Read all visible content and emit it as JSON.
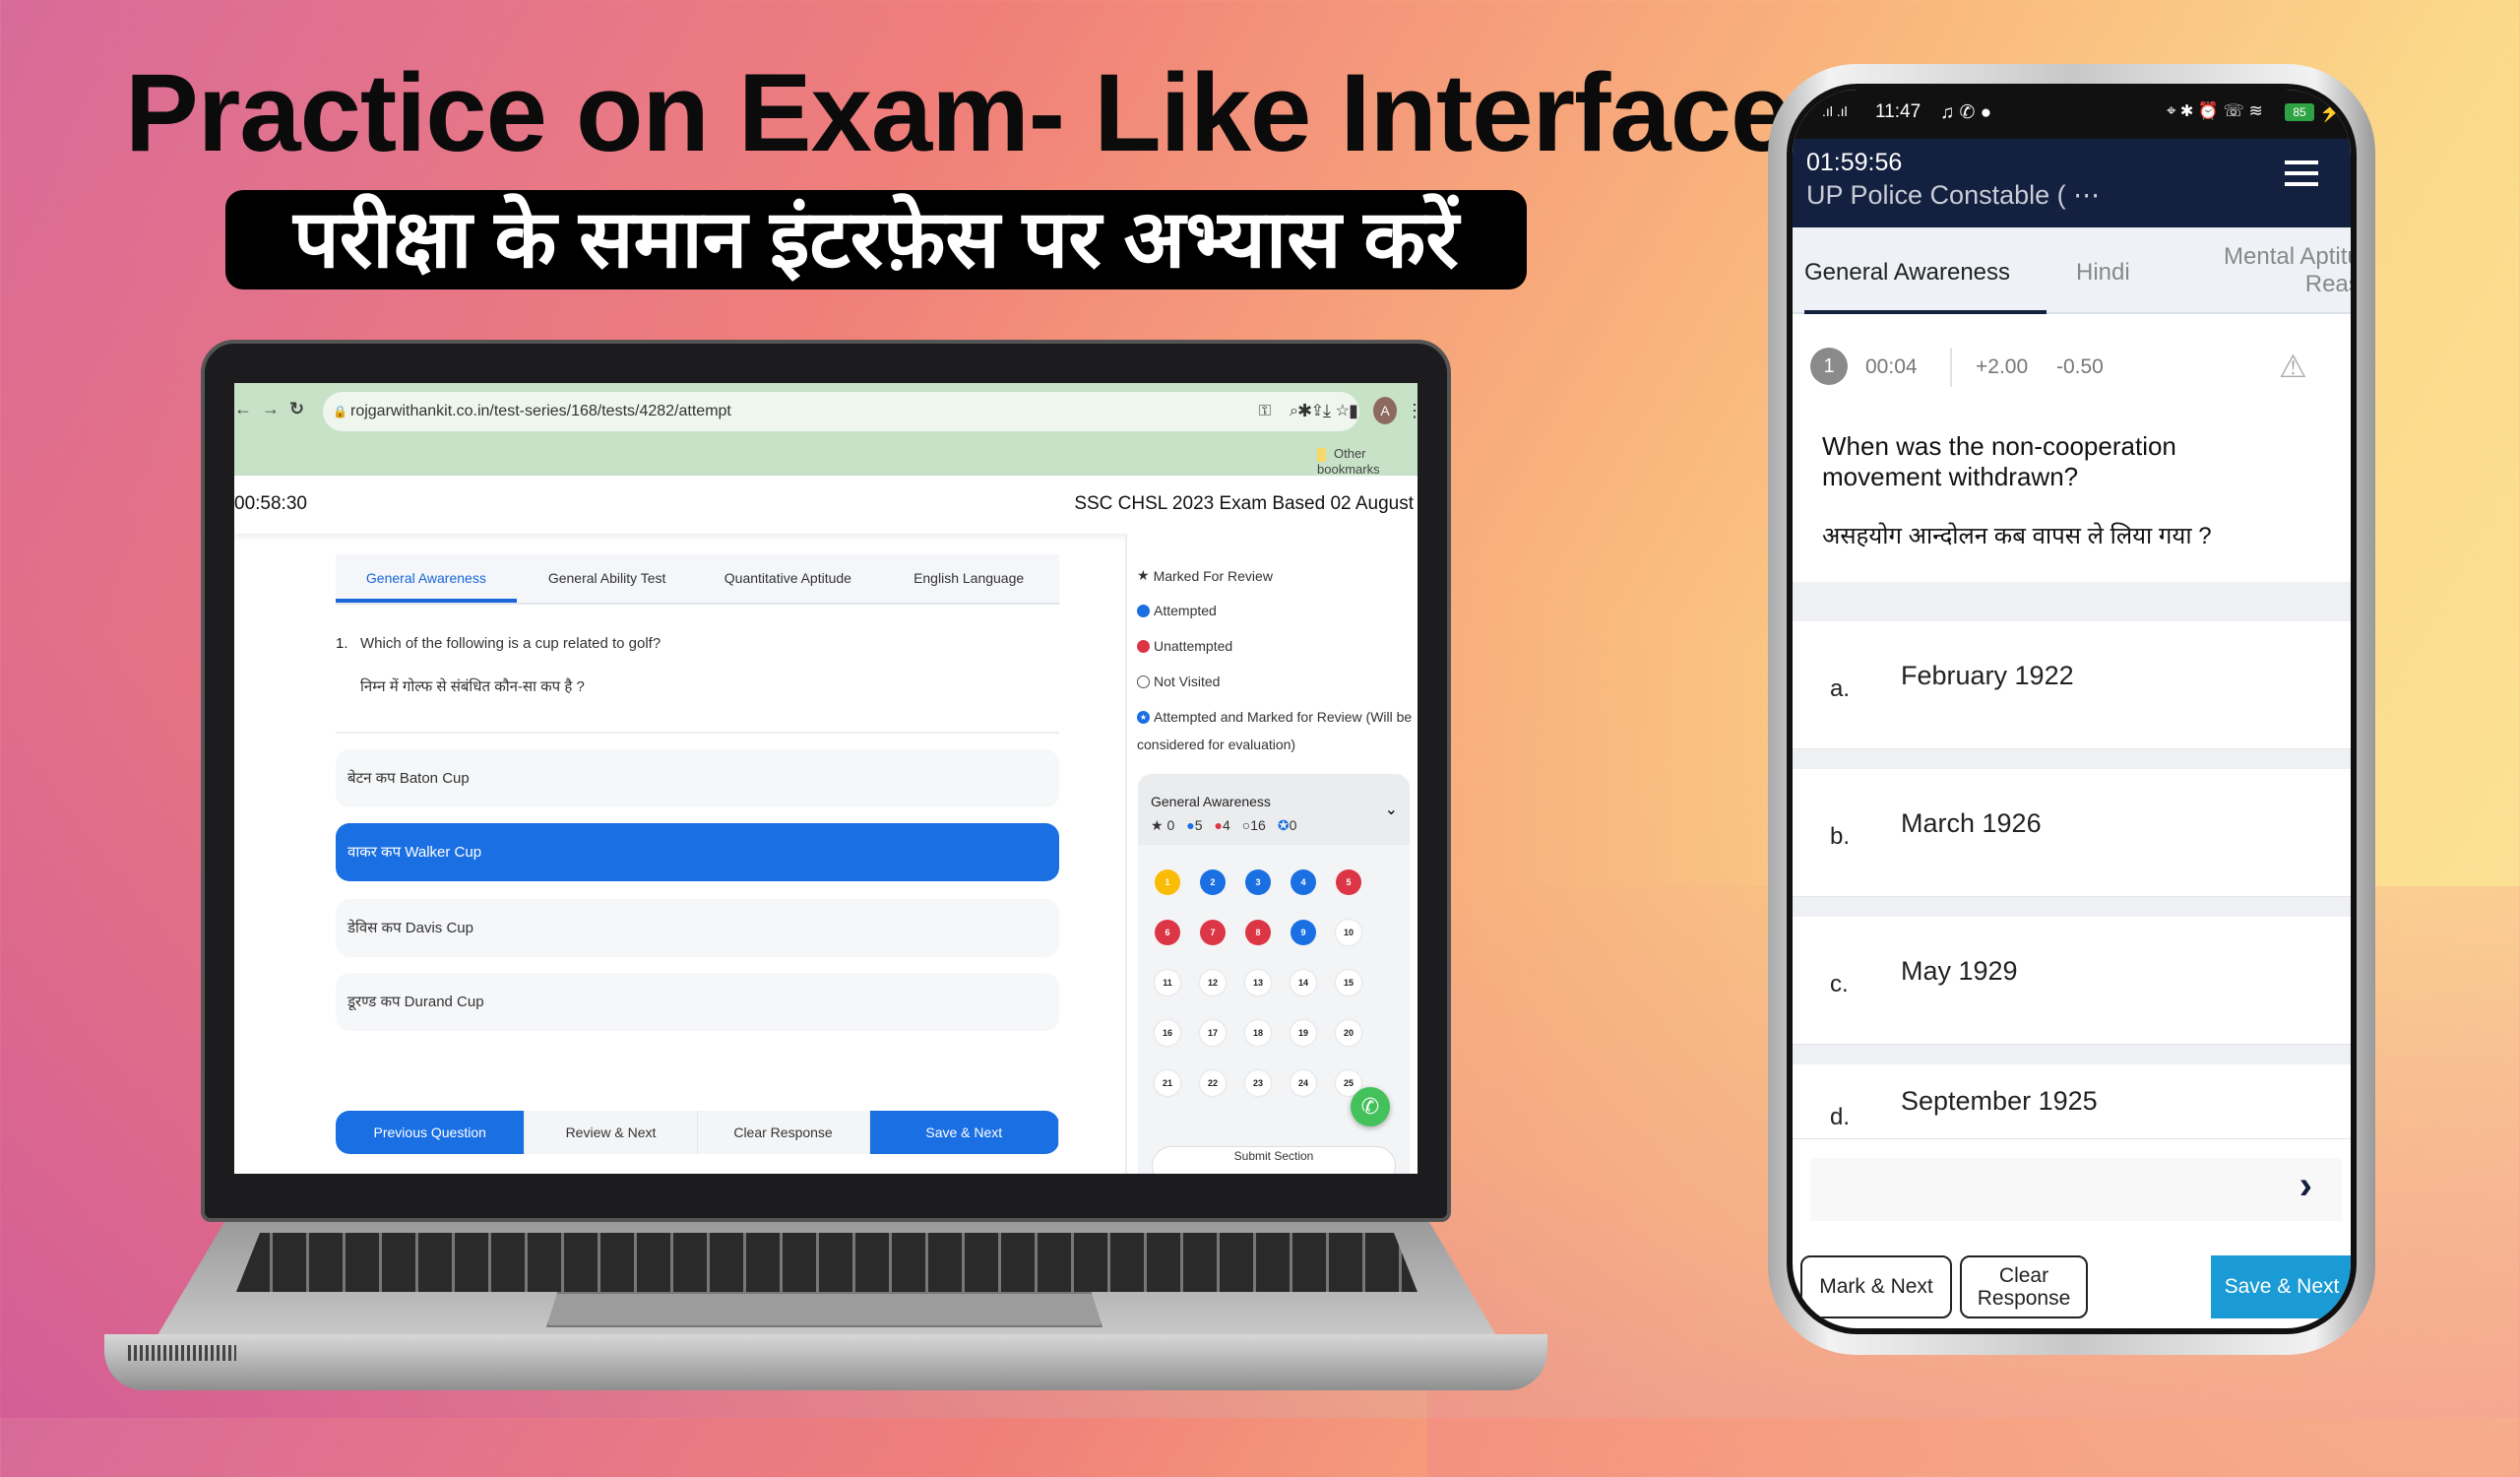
{
  "headline": "Practice on Exam- Like Interface",
  "headline_hindi": "परीक्षा के समान इंटरफ़ेस पर अभ्यास करें",
  "laptop": {
    "browser": {
      "url": "rojgarwithankit.co.in/test-series/168/tests/4282/attempt",
      "bookmarks": "Other bookmarks",
      "avatar": "A",
      "icons": [
        "back-icon",
        "forward-icon",
        "reload-icon",
        "lock-icon",
        "key-icon",
        "zoom-icon",
        "share-icon",
        "star-icon",
        "extensions-icon",
        "download-icon",
        "sidebar-icon",
        "menu-icon"
      ]
    },
    "timer": "00:58:30",
    "exam_title": "SSC CHSL 2023 Exam Based 02 August",
    "tabs": [
      {
        "label": "General Awareness",
        "active": true
      },
      {
        "label": "General Ability Test"
      },
      {
        "label": "Quantitative Aptitude"
      },
      {
        "label": "English Language"
      }
    ],
    "question": {
      "number": "1.",
      "text": "Which of the following is a cup related to golf?",
      "text_hindi": "निम्न में गोल्फ से संबंधित कौन-सा कप है ?"
    },
    "options": [
      {
        "label": "बेटन कप Baton Cup"
      },
      {
        "label": "वाकर कप Walker Cup",
        "selected": true
      },
      {
        "label": "डेविस कप Davis Cup"
      },
      {
        "label": "डूरण्ड कप Durand Cup"
      }
    ],
    "buttons": {
      "previous": "Previous Question",
      "review": "Review & Next",
      "clear": "Clear Response",
      "save": "Save & Next"
    },
    "legend": [
      {
        "label": "Marked For Review",
        "icon": "star"
      },
      {
        "label": "Attempted",
        "color": "#1a6fe3"
      },
      {
        "label": "Unattempted",
        "color": "#dc3545"
      },
      {
        "label": "Not Visited",
        "color": "#ffffff"
      },
      {
        "label": "Attempted and Marked for Review (Will be",
        "label2": "considered for evaluation)",
        "color": "#1a6fe3"
      }
    ],
    "palette": {
      "section": "General Awareness",
      "counts": {
        "marked": "0",
        "attempted": "5",
        "unattempted": "4",
        "not_visited": "16",
        "attempted_marked": "0"
      },
      "questions": [
        {
          "n": "1",
          "status": "current"
        },
        {
          "n": "2",
          "status": "attempted"
        },
        {
          "n": "3",
          "status": "attempted"
        },
        {
          "n": "4",
          "status": "attempted"
        },
        {
          "n": "5",
          "status": "unattempted"
        },
        {
          "n": "6",
          "status": "unattempted"
        },
        {
          "n": "7",
          "status": "unattempted"
        },
        {
          "n": "8",
          "status": "unattempted"
        },
        {
          "n": "9",
          "status": "attempted"
        },
        {
          "n": "10",
          "status": "not_visited"
        },
        {
          "n": "11",
          "status": "not_visited"
        },
        {
          "n": "12",
          "status": "not_visited"
        },
        {
          "n": "13",
          "status": "not_visited"
        },
        {
          "n": "14",
          "status": "not_visited"
        },
        {
          "n": "15",
          "status": "not_visited"
        },
        {
          "n": "16",
          "status": "not_visited"
        },
        {
          "n": "17",
          "status": "not_visited"
        },
        {
          "n": "18",
          "status": "not_visited"
        },
        {
          "n": "19",
          "status": "not_visited"
        },
        {
          "n": "20",
          "status": "not_visited"
        },
        {
          "n": "21",
          "status": "not_visited"
        },
        {
          "n": "22",
          "status": "not_visited"
        },
        {
          "n": "23",
          "status": "not_visited"
        },
        {
          "n": "24",
          "status": "not_visited"
        },
        {
          "n": "25",
          "status": "not_visited"
        }
      ],
      "status_colors": {
        "current": "#fbbc05",
        "attempted": "#1a6fe3",
        "unattempted": "#dc3545",
        "not_visited": "#ffffff"
      },
      "submit": "Submit Section"
    }
  },
  "phone": {
    "status_bar": {
      "time": "11:47",
      "battery": "85"
    },
    "timer": "01:59:56",
    "exam_title": "UP Police Constable ( ⋯",
    "tabs": [
      {
        "label": "General Awareness",
        "active": true
      },
      {
        "label": "Hindi"
      },
      {
        "label": "Mental Aptitud",
        "label2": "Reaso"
      }
    ],
    "question": {
      "number": "1",
      "time": "00:04",
      "positive": "+2.00",
      "negative": "-0.50",
      "text": "When was the non-cooperation movement withdrawn?",
      "text_hindi": "असहयोग आन्दोलन कब वापस ले लिया गया ?"
    },
    "options": [
      {
        "letter": "a.",
        "label": "February 1922"
      },
      {
        "letter": "b.",
        "label": "March 1926"
      },
      {
        "letter": "c.",
        "label": "May 1929"
      },
      {
        "letter": "d.",
        "label": "September 1925"
      }
    ],
    "buttons": {
      "mark": "Mark & Next",
      "clear": "Clear Response",
      "save": "Save & Next"
    },
    "colors": {
      "header": "#14203f",
      "save": "#1a9bd6"
    }
  }
}
